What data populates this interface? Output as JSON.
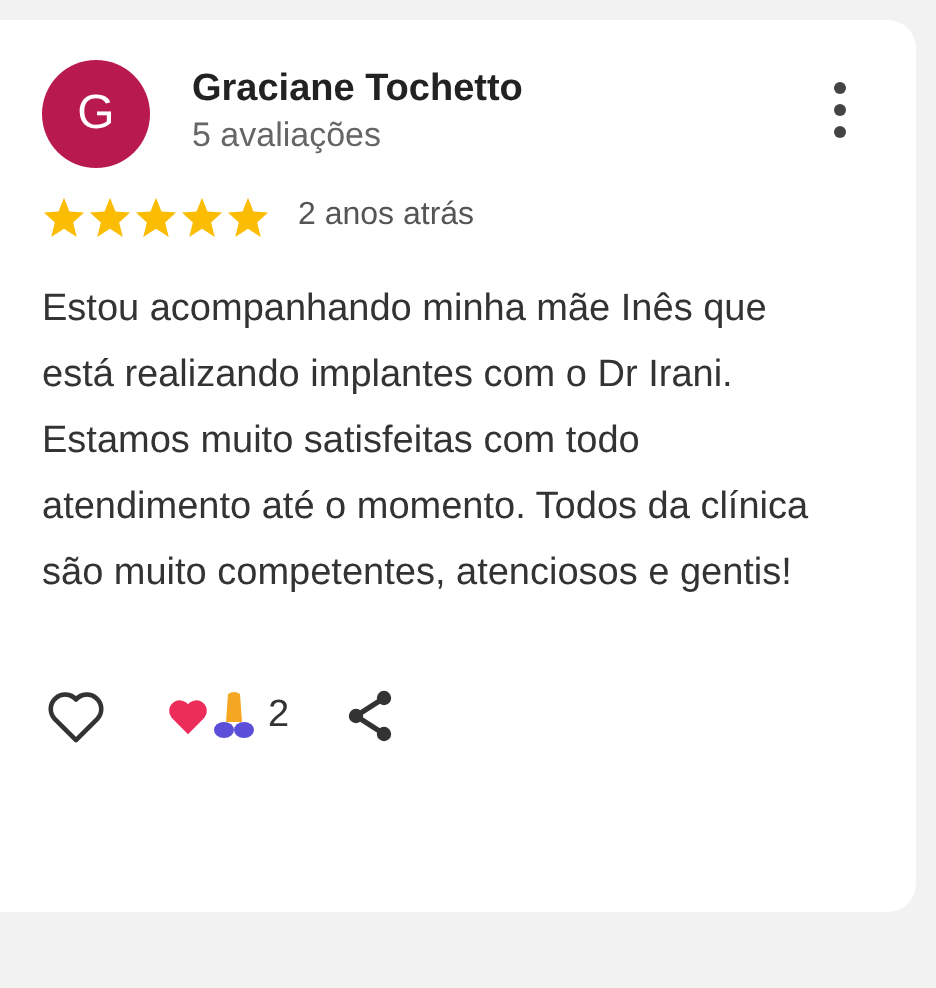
{
  "review": {
    "avatar_letter": "G",
    "author": "Graciane Tochetto",
    "author_meta": "5 avaliações",
    "stars": 5,
    "time": "2 anos atrás",
    "text": "Estou acompanhando minha mãe Inês que está realizando implantes com o Dr Irani. Estamos muito satisfeitas com todo atendimento até o momento. Todos da clínica são muito competentes, atenciosos e gentis!",
    "reaction_count": "2"
  }
}
